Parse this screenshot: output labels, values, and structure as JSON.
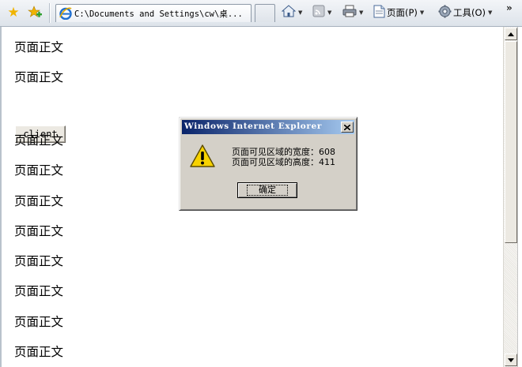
{
  "toolbar": {
    "tab_title": "C:\\Documents and Settings\\cw\\桌...",
    "page_menu_label": "页面(P)",
    "tools_menu_label": "工具(O)",
    "icons": [
      "favorites-star-icon",
      "add-favorites-icon",
      "ie-page-icon",
      "home-icon",
      "feeds-icon",
      "print-icon",
      "page-icon",
      "tools-gear-icon",
      "chevron-more-icon"
    ]
  },
  "page": {
    "paragraphs": [
      "页面正文",
      "页面正文",
      "页面正文",
      "页面正文",
      "页面正文",
      "页面正文",
      "页面正文",
      "页面正文",
      "页面正文",
      "页面正文"
    ],
    "client_button_label": "client"
  },
  "dialog": {
    "title": "Windows Internet Explorer",
    "message_line1": "页面可见区域的宽度：608",
    "message_line2": "页面可见区域的高度：411",
    "ok_label": "确定",
    "icon": "warning-icon"
  },
  "colors": {
    "titlebar_start": "#0a246a",
    "titlebar_end": "#a6caf0",
    "dialog_bg": "#d4d0c8"
  }
}
